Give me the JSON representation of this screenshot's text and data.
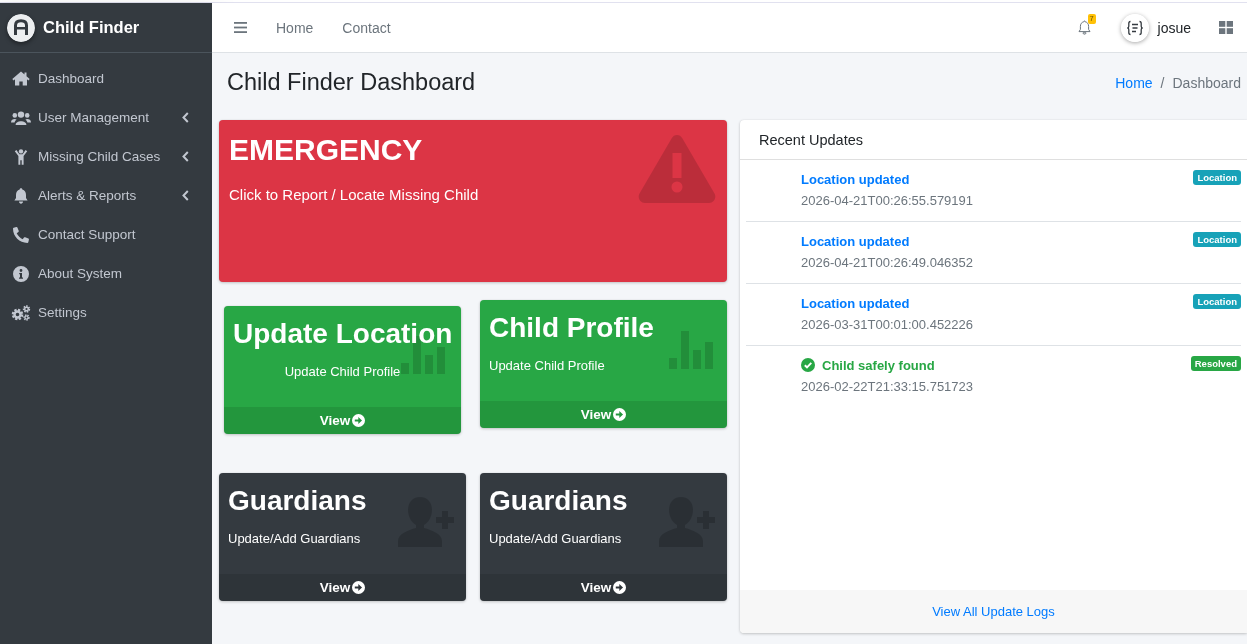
{
  "sidebar": {
    "brand": "Child Finder",
    "items": [
      {
        "label": "Dashboard",
        "kind": "link"
      },
      {
        "label": "User Management",
        "kind": "submenu"
      },
      {
        "label": "Missing Child Cases",
        "kind": "submenu"
      },
      {
        "label": "Alerts & Reports",
        "kind": "submenu"
      },
      {
        "label": "Contact Support",
        "kind": "link"
      },
      {
        "label": "About System",
        "kind": "link"
      },
      {
        "label": "Settings",
        "kind": "link"
      }
    ]
  },
  "navbar": {
    "links": [
      "Home",
      "Contact"
    ],
    "notification_count": "7",
    "user": "josue"
  },
  "header": {
    "title": "Child Finder Dashboard",
    "breadcrumb": [
      {
        "label": "Home",
        "kind": "link"
      },
      {
        "label": "Dashboard",
        "kind": "current"
      }
    ],
    "breadcrumb_separator": "/"
  },
  "emergency": {
    "title": "EMERGENCY",
    "subtitle": "Click to Report / Locate Missing Child"
  },
  "tiles": [
    {
      "title": "Update Location",
      "subtitle": "Update Child Profile",
      "link": "View",
      "kind": "chart",
      "color": "#28a745"
    },
    {
      "title": "Child Profile",
      "subtitle": "Update Child Profile",
      "link": "View",
      "kind": "chart",
      "color": "#28a745"
    },
    {
      "title": "Guardians",
      "subtitle": "Update/Add Guardians",
      "link": "View",
      "kind": "guardian",
      "color": "#343a40"
    },
    {
      "title": "Guardians",
      "subtitle": "Update/Add Guardians",
      "link": "View",
      "kind": "guardian",
      "color": "#343a40"
    }
  ],
  "recent_updates": {
    "title": "Recent Updates",
    "items": [
      {
        "title": "Location updated",
        "timestamp": "2026-04-21T00:26:55.579191",
        "badge": "Location",
        "kind": "location",
        "color": "#17a2b8"
      },
      {
        "title": "Location updated",
        "timestamp": "2026-04-21T00:26:49.046352",
        "badge": "Location",
        "kind": "location",
        "color": "#17a2b8"
      },
      {
        "title": "Location updated",
        "timestamp": "2026-03-31T00:01:00.452226",
        "badge": "Location",
        "kind": "location",
        "color": "#17a2b8"
      },
      {
        "title": "Child safely found",
        "timestamp": "2026-02-22T21:33:15.751723",
        "badge": "Resolved",
        "kind": "resolved",
        "color": "#28a745"
      }
    ],
    "footer_link": "View All Update Logs"
  }
}
